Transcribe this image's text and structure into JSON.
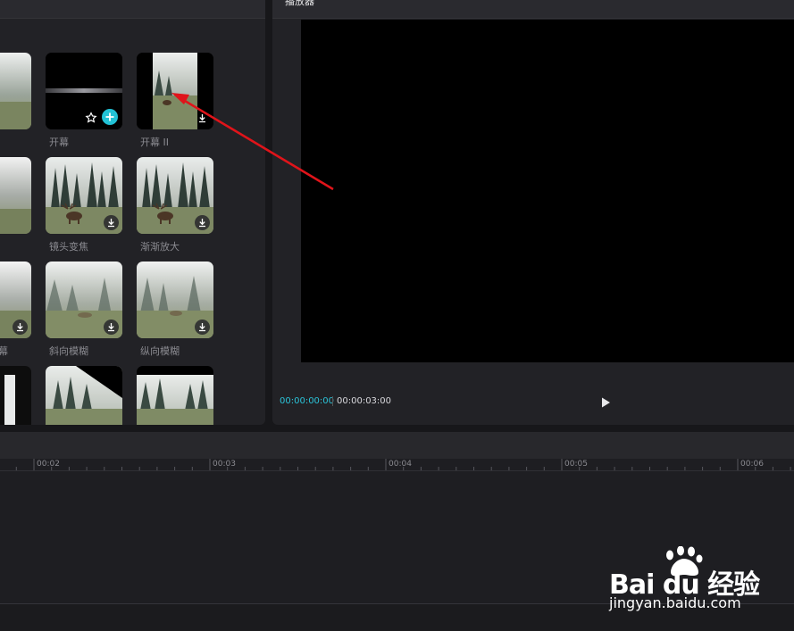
{
  "player": {
    "title": "播放器",
    "timecode_current": "00:00:00:00",
    "timecode_total": "00:00:03:00"
  },
  "transitions": {
    "items": [
      {
        "label": "开幕",
        "action_icon": "add-icon"
      },
      {
        "label": "开幕 II",
        "action_icon": "download-icon"
      },
      {
        "label": "镜头变焦",
        "action_icon": "download-icon"
      },
      {
        "label": "渐渐放大",
        "action_icon": "download-icon"
      },
      {
        "label": "斜向模糊",
        "action_icon": "download-icon"
      },
      {
        "label": "纵向模糊",
        "action_icon": "download-icon"
      }
    ],
    "partial_labels": [
      "",
      "",
      "幕"
    ]
  },
  "timeline": {
    "ruler": [
      "00:02",
      "00:03",
      "00:04",
      "00:05",
      "00:06"
    ]
  },
  "watermark": {
    "brand": "Bai du 经验",
    "url": "jingyan.baidu.com"
  },
  "colors": {
    "accent": "#2bc3d8",
    "arrow": "#e0141a"
  }
}
